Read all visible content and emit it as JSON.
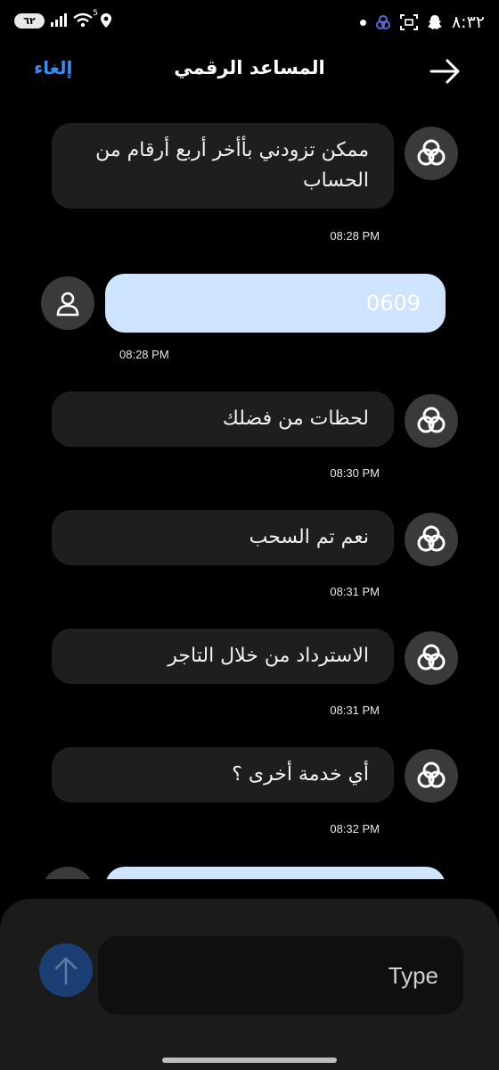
{
  "status_bar": {
    "time": "٨:٣٢",
    "battery": "٦٢",
    "network": "5"
  },
  "header": {
    "title": "المساعد الرقمي",
    "cancel_label": "إلغاء"
  },
  "messages": [
    {
      "sender": "bot",
      "text": "ممكن تزودني بأأخر أربع أرقام من الحساب",
      "time": "08:28 PM"
    },
    {
      "sender": "user",
      "text": "0609",
      "time": "08:28 PM"
    },
    {
      "sender": "bot",
      "text": "لحظات من فضلك",
      "time": "08:30 PM"
    },
    {
      "sender": "bot",
      "text": "نعم تم السحب",
      "time": "08:31 PM"
    },
    {
      "sender": "bot",
      "text": "الاسترداد من خلال التاجر",
      "time": "08:31 PM"
    },
    {
      "sender": "bot",
      "text": "أي خدمة أخرى ؟",
      "time": "08:32 PM"
    }
  ],
  "composer": {
    "placeholder": "Type"
  },
  "colors": {
    "accent": "#3b8cf0",
    "user_bubble": "#cfe4ff",
    "bot_bubble": "#1e1e1e",
    "send_button": "#1b3f74"
  }
}
